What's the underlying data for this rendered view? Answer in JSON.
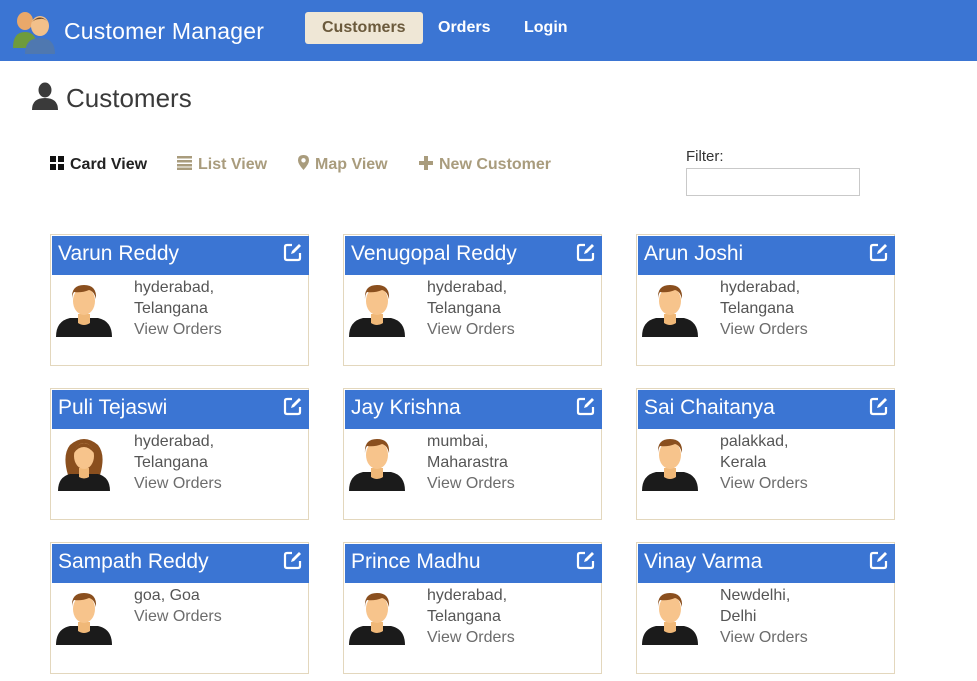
{
  "app": {
    "title": "Customer Manager"
  },
  "nav": [
    {
      "label": "Customers",
      "active": true
    },
    {
      "label": "Orders",
      "active": false
    },
    {
      "label": "Login",
      "active": false
    }
  ],
  "page": {
    "title": "Customers"
  },
  "toolbar": {
    "card_view": "Card View",
    "list_view": "List View",
    "map_view": "Map View",
    "new_customer": "New Customer"
  },
  "filter": {
    "label": "Filter:",
    "value": ""
  },
  "colors": {
    "brand": "#3b75d3",
    "active_tab_bg": "#efe7d6",
    "toolbar_text": "#a99c7d",
    "card_border": "#e3d7bd"
  },
  "customers": [
    {
      "name": "Varun Reddy",
      "city": "hyderabad,",
      "state": "Telangana",
      "orders": "View Orders",
      "gender": "male"
    },
    {
      "name": "Venugopal Reddy",
      "city": "hyderabad,",
      "state": "Telangana",
      "orders": "View Orders",
      "gender": "male"
    },
    {
      "name": "Arun Joshi",
      "city": "hyderabad,",
      "state": "Telangana",
      "orders": "View Orders",
      "gender": "male"
    },
    {
      "name": "Puli Tejaswi",
      "city": "hyderabad,",
      "state": "Telangana",
      "orders": "View Orders",
      "gender": "female"
    },
    {
      "name": "Jay Krishna",
      "city": "mumbai,",
      "state": "Maharastra",
      "orders": "View Orders",
      "gender": "male"
    },
    {
      "name": "Sai Chaitanya",
      "city": "palakkad,",
      "state": "Kerala",
      "orders": "View Orders",
      "gender": "male"
    },
    {
      "name": "Sampath Reddy",
      "city": "goa, Goa",
      "state": "",
      "orders": "View Orders",
      "gender": "male"
    },
    {
      "name": "Prince Madhu",
      "city": "hyderabad,",
      "state": "Telangana",
      "orders": "View Orders",
      "gender": "male"
    },
    {
      "name": "Vinay Varma",
      "city": "Newdelhi,",
      "state": "Delhi",
      "orders": "View Orders",
      "gender": "male"
    }
  ]
}
